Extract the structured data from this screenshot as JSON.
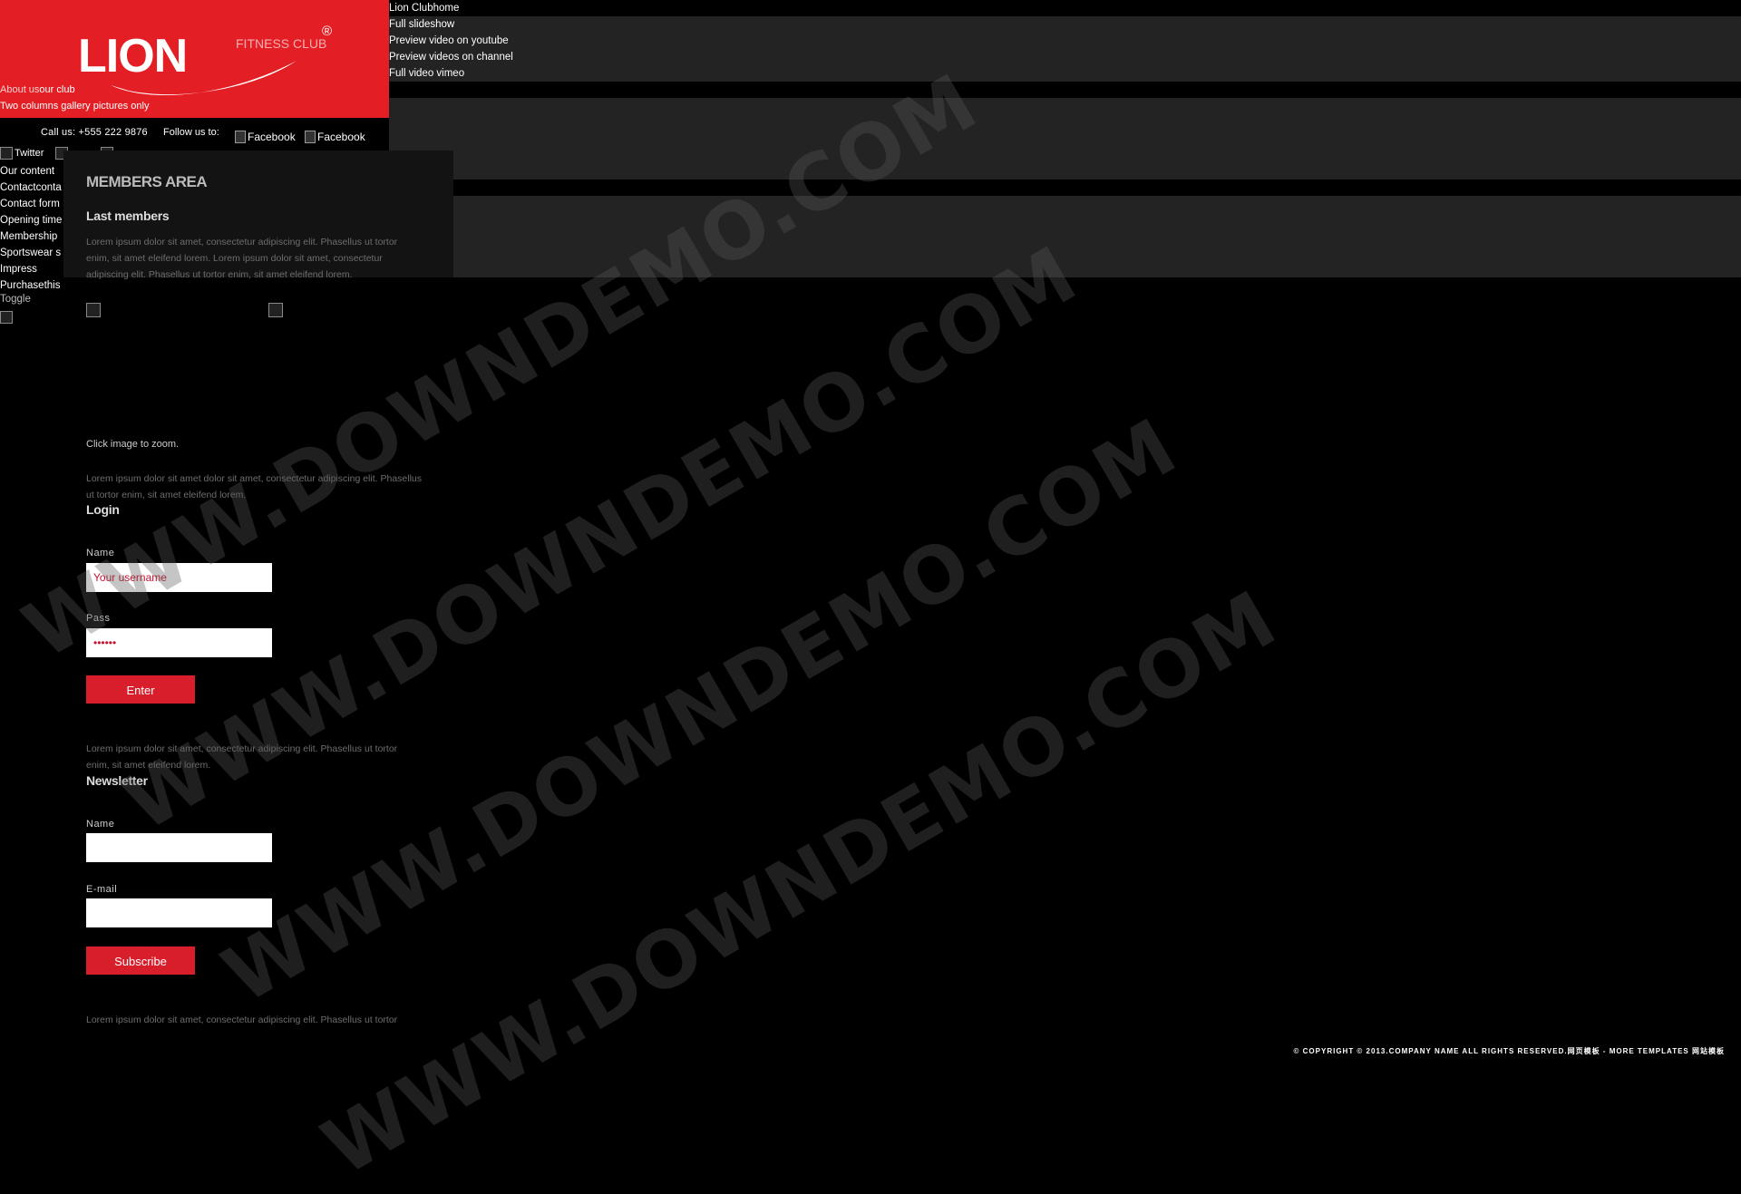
{
  "brand": {
    "logo_word": "LION",
    "logo_sub": "FITNESS CLUB",
    "logo_reg": "®"
  },
  "header_links": {
    "about_part1": "About us",
    "about_part2": "our club",
    "two_columns": "Two columns gallery pictures only"
  },
  "top_menu": [
    {
      "label": "Lion Club",
      "label2": "home"
    },
    {
      "label": "Full slideshow"
    },
    {
      "label": "Preview video on youtube"
    },
    {
      "label": "Preview videos on channel"
    },
    {
      "label": "Full video vimeo"
    }
  ],
  "contact": {
    "call": "Call us: +555 222 9876",
    "follow": "Follow us to:",
    "social_1": "Facebook",
    "social_2": "Facebook"
  },
  "icon_row": {
    "text": "Twitter"
  },
  "side_nav": [
    "Our content",
    "Contactconta",
    "Contact form",
    "Opening time",
    "Membership",
    "Sportswear s",
    "Impress",
    "Purchasethis"
  ],
  "toggle": "Toggle",
  "members": {
    "title": "MEMBERS AREA",
    "last_members": "Last members",
    "lorem_1": "Lorem ipsum dolor sit amet, consectetur adipiscing elit. Phasellus ut tortor enim, sit amet eleifend lorem. Lorem ipsum dolor sit amet, consectetur adipiscing elit. Phasellus ut tortor enim, sit amet eleifend lorem.",
    "zoom_note": "Click image to zoom.",
    "lorem_2": "Lorem ipsum dolor sit amet dolor sit amet, consectetur adipiscing elit. Phasellus ut tortor enim, sit amet eleifend lorem."
  },
  "login": {
    "title": "Login",
    "name_label": "Name",
    "name_value": "Your username",
    "pass_label": "Pass",
    "pass_value": "••••••",
    "enter": "Enter",
    "lorem": "Lorem ipsum dolor sit amet, consectetur adipiscing elit. Phasellus ut tortor enim, sit amet eleifend lorem."
  },
  "newsletter": {
    "title": "Newsletter",
    "name_label": "Name",
    "email_label": "E-mail",
    "subscribe": "Subscribe",
    "lorem": "Lorem ipsum dolor sit amet, consectetur adipiscing elit. Phasellus ut tortor enim, sit amet eleifend lorem."
  },
  "footer": {
    "copyright": "© COPYRIGHT © 2013.COMPANY NAME ALL RIGHTS RESERVED.网页模板 - MORE TEMPLATES 网站模板"
  },
  "watermark": "WWW.DOWNDEMO.COM",
  "colors": {
    "brand_red": "#e31e24",
    "button_red": "#d81e2b",
    "background": "#000000",
    "band": "#232323"
  }
}
